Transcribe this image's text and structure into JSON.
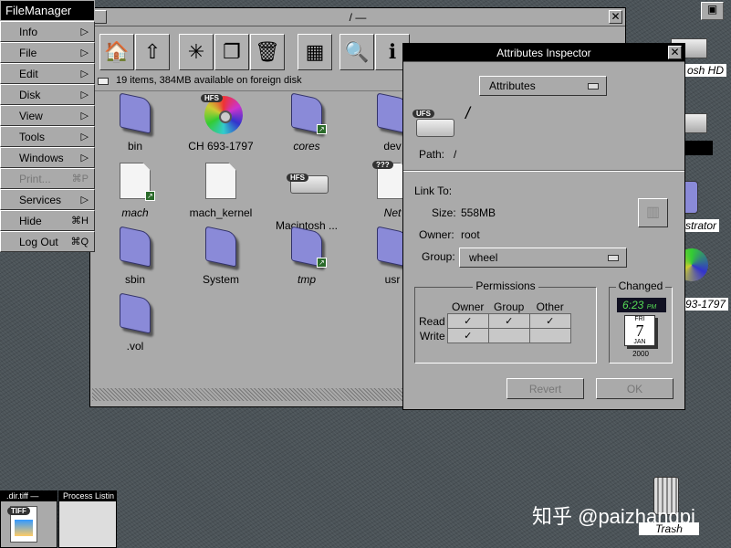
{
  "menu": {
    "title": "FileManager",
    "items": [
      {
        "label": "Info",
        "key": "▷"
      },
      {
        "label": "File",
        "key": "▷"
      },
      {
        "label": "Edit",
        "key": "▷"
      },
      {
        "label": "Disk",
        "key": "▷"
      },
      {
        "label": "View",
        "key": "▷"
      },
      {
        "label": "Tools",
        "key": "▷"
      },
      {
        "label": "Windows",
        "key": "▷"
      },
      {
        "label": "Print...",
        "key": "⌘P",
        "disabled": true
      },
      {
        "label": "Services",
        "key": "▷"
      },
      {
        "label": "Hide",
        "key": "⌘H"
      },
      {
        "label": "Log Out",
        "key": "⌘Q"
      }
    ]
  },
  "viewer": {
    "title": "/ —",
    "status": "19 items, 384MB available on foreign disk",
    "toolbar": [
      "home",
      "parent-folder",
      "new-folder",
      "copy",
      "recycler",
      "view-mode",
      "find",
      "info"
    ],
    "items": [
      {
        "name": "bin",
        "type": "folder"
      },
      {
        "name": "CH 693-1797",
        "type": "cd",
        "tag": "HFS"
      },
      {
        "name": "cores",
        "type": "folder",
        "link": true
      },
      {
        "name": "dev",
        "type": "folder"
      },
      {
        "name": "mach",
        "type": "doc",
        "link": true
      },
      {
        "name": "mach_kernel",
        "type": "doc"
      },
      {
        "name": "Macintosh ...",
        "type": "disk",
        "tag": "HFS"
      },
      {
        "name": "Net",
        "type": "doc",
        "tag": "???",
        "link": true
      },
      {
        "name": "sbin",
        "type": "folder"
      },
      {
        "name": "System",
        "type": "folder"
      },
      {
        "name": "tmp",
        "type": "folder",
        "link": true
      },
      {
        "name": "usr",
        "type": "folder"
      },
      {
        "name": ".vol",
        "type": "folder"
      }
    ]
  },
  "inspector": {
    "title": "Attributes Inspector",
    "mode": "Attributes",
    "fs_tag": "UFS",
    "name": "/",
    "path_label": "Path:",
    "path": "/",
    "link_label": "Link To:",
    "size_label": "Size:",
    "size": "558MB",
    "owner_label": "Owner:",
    "owner": "root",
    "group_label": "Group:",
    "group": "wheel",
    "permissions": {
      "title": "Permissions",
      "cols": [
        "Owner",
        "Group",
        "Other"
      ],
      "rows": [
        {
          "label": "Read",
          "values": [
            "✓",
            "✓",
            "✓"
          ]
        },
        {
          "label": "Write",
          "values": [
            "✓",
            "",
            ""
          ]
        }
      ]
    },
    "changed": {
      "title": "Changed",
      "time": "6:23",
      "ampm": "PM",
      "weekday": "FRI",
      "day": "7",
      "month": "JAN",
      "year": "2000"
    },
    "revert": "Revert",
    "ok": "OK"
  },
  "desktop": {
    "labels": [
      "osh HD",
      "strator",
      "93-1797"
    ],
    "trash": "Trash",
    "watermark": "知乎 @paizhangpi"
  },
  "miniwindows": [
    {
      "title": ".dir.tiff —",
      "tag": "TIFF"
    },
    {
      "title": "Process Listin"
    }
  ]
}
